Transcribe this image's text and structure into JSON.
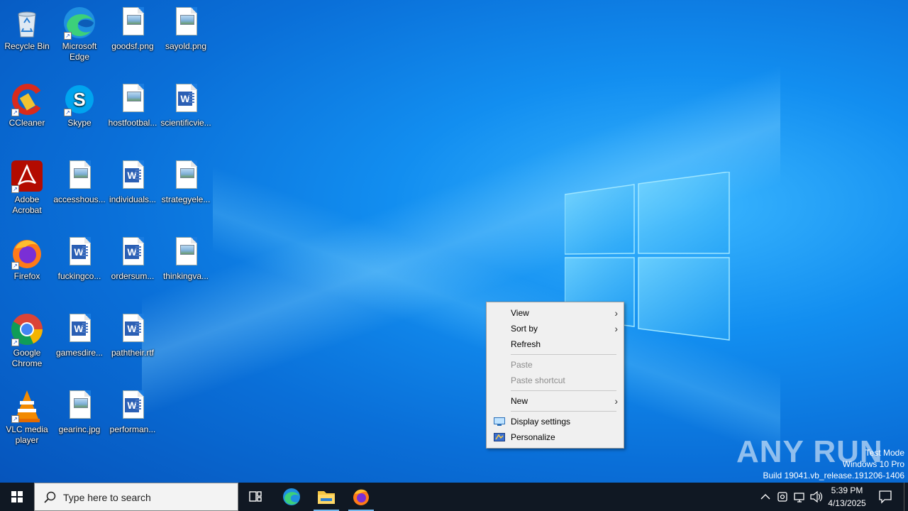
{
  "desktop_icons": [
    {
      "label": "Recycle Bin",
      "icon": "recycle-bin-icon"
    },
    {
      "label": "Microsoft Edge",
      "icon": "edge-icon"
    },
    {
      "label": "goodsf.png",
      "icon": "image-file-icon"
    },
    {
      "label": "sayold.png",
      "icon": "image-file-icon"
    },
    {
      "label": "CCleaner",
      "icon": "ccleaner-icon"
    },
    {
      "label": "Skype",
      "icon": "skype-icon"
    },
    {
      "label": "hostfootbal...",
      "icon": "image-file-icon"
    },
    {
      "label": "scientificvie...",
      "icon": "word-doc-icon"
    },
    {
      "label": "Adobe Acrobat",
      "icon": "acrobat-icon"
    },
    {
      "label": "accesshous...",
      "icon": "image-file-icon"
    },
    {
      "label": "individuals...",
      "icon": "word-doc-icon"
    },
    {
      "label": "strategyele...",
      "icon": "image-file-icon"
    },
    {
      "label": "Firefox",
      "icon": "firefox-icon"
    },
    {
      "label": "fuckingco...",
      "icon": "word-doc-icon"
    },
    {
      "label": "ordersum...",
      "icon": "word-doc-icon"
    },
    {
      "label": "thinkingva...",
      "icon": "image-file-icon"
    },
    {
      "label": "Google Chrome",
      "icon": "chrome-icon"
    },
    {
      "label": "gamesdire...",
      "icon": "word-doc-icon"
    },
    {
      "label": "paththeir.rtf",
      "icon": "word-doc-icon"
    },
    {
      "label": "VLC media player",
      "icon": "vlc-icon"
    },
    {
      "label": "gearinc.jpg",
      "icon": "image-file-icon"
    },
    {
      "label": "performan...",
      "icon": "word-doc-icon"
    }
  ],
  "context_menu": {
    "view": "View",
    "sort_by": "Sort by",
    "refresh": "Refresh",
    "paste": "Paste",
    "paste_shortcut": "Paste shortcut",
    "new": "New",
    "display_settings": "Display settings",
    "personalize": "Personalize"
  },
  "watermark": {
    "brand": "ANY RUN",
    "line1": "Test Mode",
    "line2": "Windows 10 Pro",
    "line3": "Build 19041.vb_release.191206-1406"
  },
  "taskbar": {
    "search_placeholder": "Type here to search",
    "time": "5:39 PM",
    "date": "4/13/2025"
  },
  "colors": {
    "desktop_accent": "#128ef0",
    "taskbar_bg": "#101823",
    "menu_bg": "#f0f0f0"
  }
}
